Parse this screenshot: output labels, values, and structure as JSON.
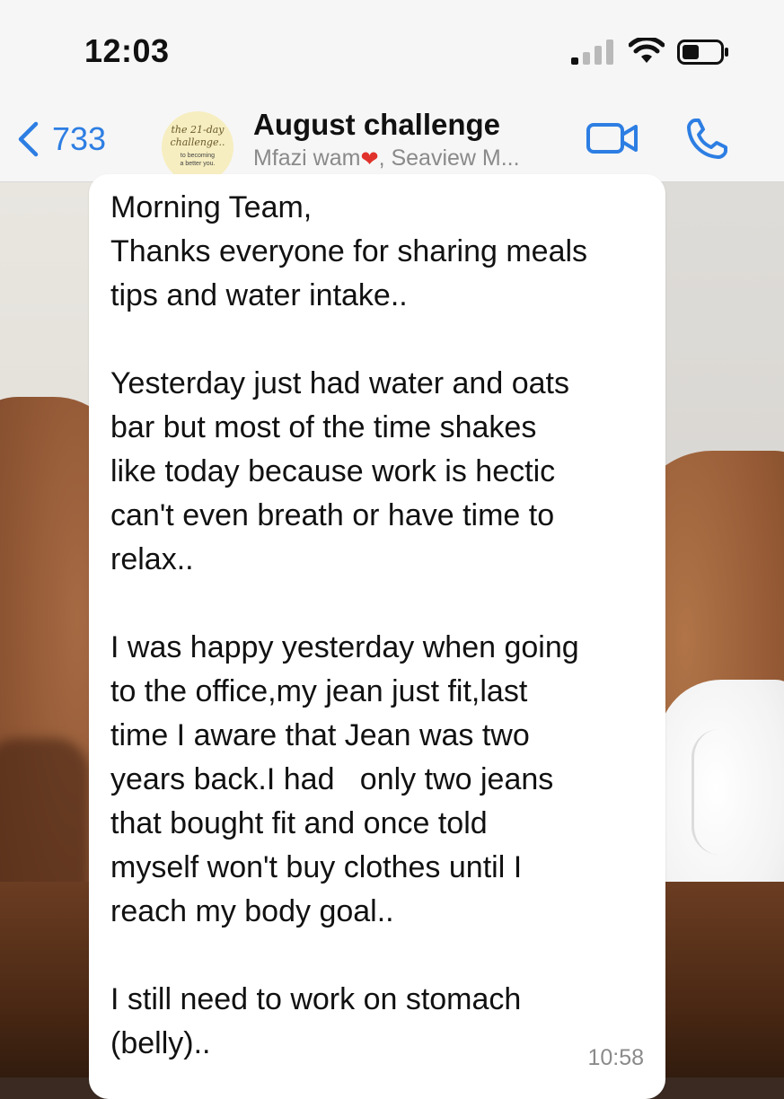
{
  "status_bar": {
    "time": "12:03",
    "signal_icon": "cellular-signal-icon",
    "wifi_icon": "wifi-icon",
    "battery_icon": "battery-icon"
  },
  "header": {
    "back_icon": "chevron-left-icon",
    "back_count": "733",
    "avatar": {
      "line1": "the 21-day",
      "line2": "challenge..",
      "sub1": "to becoming",
      "sub2": "a better you."
    },
    "title": "August challenge",
    "subtitle_before": "Mfazi wam",
    "subtitle_emoji": "❤",
    "subtitle_after": ", Seaview M...",
    "video_icon": "video-call-icon",
    "call_icon": "phone-icon",
    "accent_color": "#2d7ee3"
  },
  "message": {
    "lines": [
      "Morning Team,",
      "Thanks everyone for sharing meals",
      "tips and water intake..",
      "",
      "Yesterday just had water and oats",
      "bar but most of the time shakes",
      "like today because work is hectic",
      "can't even breath or have time to",
      "relax..",
      "",
      "I was happy yesterday when going",
      "to the office,my jean just fit,last",
      "time I aware that Jean was two",
      "years back.I had   only two jeans",
      "that bought fit and once told",
      "myself won't buy clothes until I",
      "reach my body goal..",
      "",
      "I still need to work on stomach",
      "(belly).."
    ],
    "time": "10:58"
  }
}
